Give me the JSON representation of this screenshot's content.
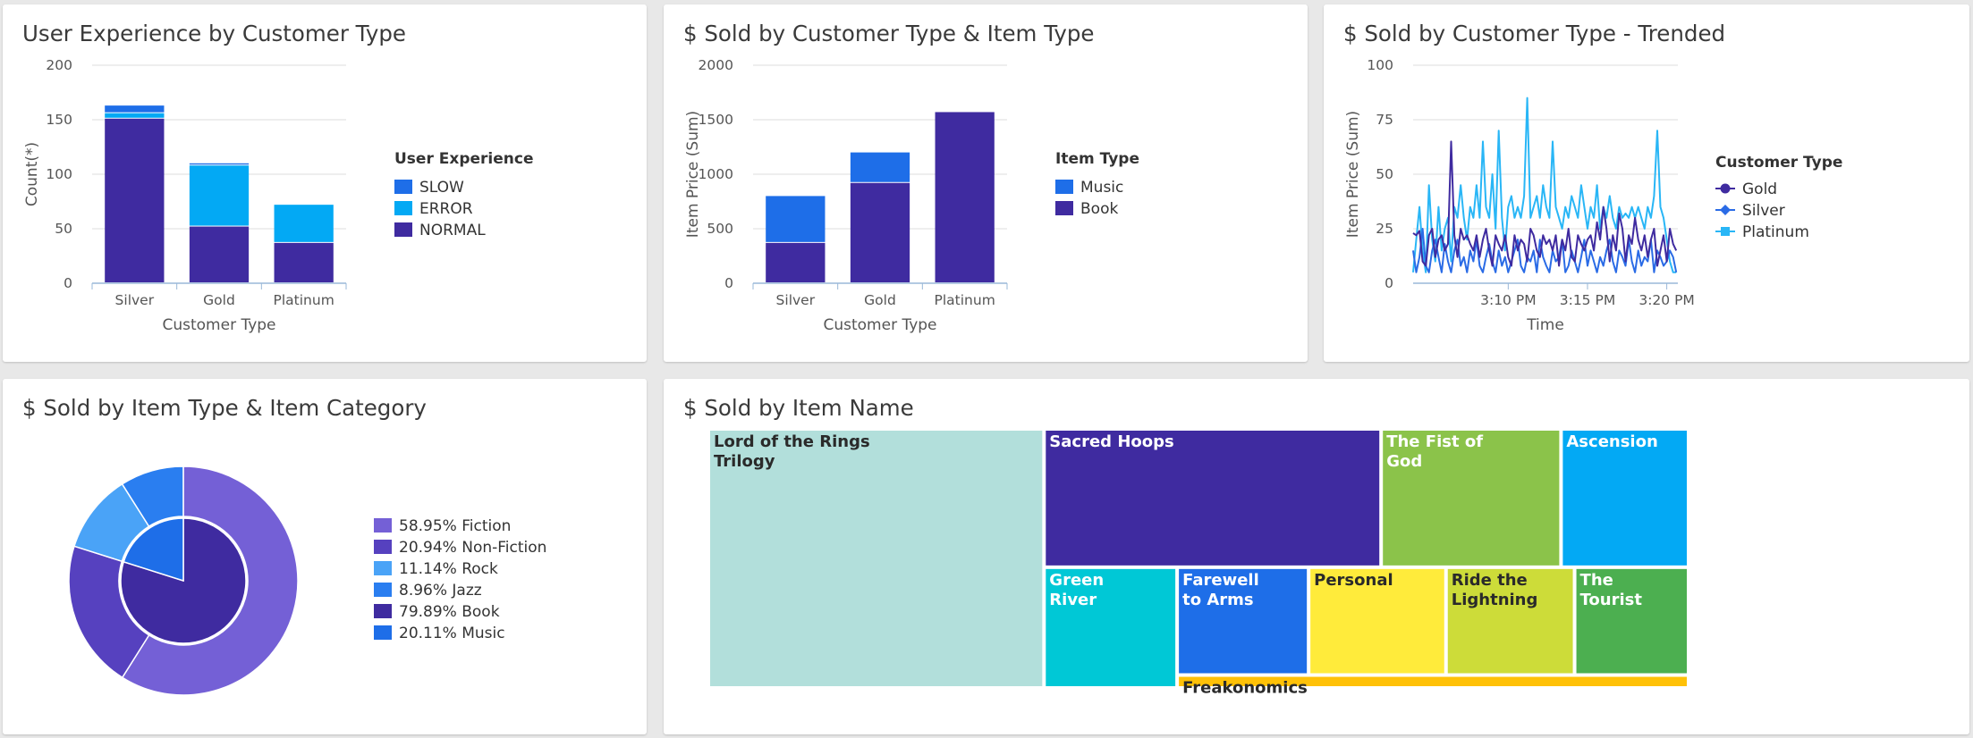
{
  "colors": {
    "normal": "#3f2ba0",
    "error": "#03a9f4",
    "slow": "#1e6ee8",
    "music": "#1e6ee8",
    "book": "#3f2ba0",
    "gold": "#3f2ba0",
    "silver": "#2a6be6",
    "platinum": "#29b6f6"
  },
  "chart_data": [
    {
      "type": "bar",
      "title": "User Experience by Customer Type",
      "xlabel": "Customer Type",
      "ylabel": "Count(*)",
      "ylim": [
        0,
        200
      ],
      "yticks": [
        0,
        50,
        100,
        150,
        200
      ],
      "categories": [
        "Silver",
        "Gold",
        "Platinum"
      ],
      "legend_title": "User Experience",
      "legend_placement": "right",
      "stacked": true,
      "series": [
        {
          "name": "NORMAL",
          "values": [
            151,
            52,
            37
          ]
        },
        {
          "name": "ERROR",
          "values": [
            5,
            56,
            35
          ]
        },
        {
          "name": "SLOW",
          "values": [
            7,
            2,
            0
          ]
        }
      ],
      "legend_order": [
        "SLOW",
        "ERROR",
        "NORMAL"
      ]
    },
    {
      "type": "bar",
      "title": "$ Sold by Customer Type & Item Type",
      "xlabel": "Customer Type",
      "ylabel": "Item Price (Sum)",
      "ylim": [
        0,
        2000
      ],
      "yticks": [
        0,
        500,
        1000,
        1500,
        2000
      ],
      "categories": [
        "Silver",
        "Gold",
        "Platinum"
      ],
      "legend_title": "Item Type",
      "legend_placement": "right",
      "stacked": true,
      "series": [
        {
          "name": "Book",
          "values": [
            370,
            920,
            1570
          ]
        },
        {
          "name": "Music",
          "values": [
            430,
            280,
            0
          ]
        }
      ],
      "legend_order": [
        "Music",
        "Book"
      ]
    },
    {
      "type": "line",
      "title": "$ Sold by Customer Type - Trended",
      "xlabel": "Time",
      "ylabel": "Item Price (Sum)",
      "ylim": [
        0,
        100
      ],
      "yticks": [
        0,
        25,
        50,
        75,
        100
      ],
      "xticks": [
        "3:10 PM",
        "3:15 PM",
        "3:20 PM"
      ],
      "xtick_positions": [
        6,
        11,
        16
      ],
      "xlim": [
        0,
        16.7
      ],
      "legend_title": "Customer Type",
      "legend_placement": "right",
      "series": [
        {
          "name": "Gold",
          "marker": "circle",
          "x": [
            0,
            0.2,
            0.4,
            0.6,
            0.8,
            1,
            1.2,
            1.4,
            1.6,
            1.8,
            2,
            2.2,
            2.4,
            2.6,
            2.8,
            3,
            3.2,
            3.4,
            3.6,
            3.8,
            4,
            4.2,
            4.4,
            4.6,
            4.8,
            5,
            5.2,
            5.4,
            5.6,
            5.8,
            6,
            6.2,
            6.4,
            6.6,
            6.8,
            7,
            7.2,
            7.4,
            7.6,
            7.8,
            8,
            8.2,
            8.4,
            8.6,
            8.8,
            9,
            9.2,
            9.4,
            9.6,
            9.8,
            10,
            10.2,
            10.4,
            10.6,
            10.8,
            11,
            11.2,
            11.4,
            11.6,
            11.8,
            12,
            12.2,
            12.4,
            12.6,
            12.8,
            13,
            13.2,
            13.4,
            13.6,
            13.8,
            14,
            14.2,
            14.4,
            14.6,
            14.8,
            15,
            15.2,
            15.4,
            15.6,
            15.8,
            16,
            16.2,
            16.4,
            16.6
          ],
          "y": [
            23,
            22,
            24,
            10,
            8,
            22,
            25,
            12,
            20,
            22,
            15,
            18,
            65,
            22,
            12,
            25,
            20,
            22,
            18,
            15,
            22,
            12,
            20,
            25,
            15,
            8,
            22,
            18,
            15,
            22,
            12,
            8,
            22,
            15,
            20,
            18,
            10,
            25,
            22,
            15,
            12,
            22,
            18,
            20,
            15,
            22,
            8,
            20,
            15,
            25,
            12,
            10,
            22,
            18,
            15,
            20,
            22,
            15,
            28,
            20,
            35,
            25,
            10,
            22,
            15,
            32,
            25,
            10,
            22,
            18,
            30,
            20,
            15,
            22,
            12,
            20,
            25,
            8,
            15,
            22,
            10,
            25,
            18,
            15
          ]
        },
        {
          "name": "Silver",
          "marker": "diamond",
          "x": [
            0,
            0.2,
            0.4,
            0.6,
            0.8,
            1,
            1.2,
            1.4,
            1.6,
            1.8,
            2,
            2.2,
            2.4,
            2.6,
            2.8,
            3,
            3.2,
            3.4,
            3.6,
            3.8,
            4,
            4.2,
            4.4,
            4.6,
            4.8,
            5,
            5.2,
            5.4,
            5.6,
            5.8,
            6,
            6.2,
            6.4,
            6.6,
            6.8,
            7,
            7.2,
            7.4,
            7.6,
            7.8,
            8,
            8.2,
            8.4,
            8.6,
            8.8,
            9,
            9.2,
            9.4,
            9.6,
            9.8,
            10,
            10.2,
            10.4,
            10.6,
            10.8,
            11,
            11.2,
            11.4,
            11.6,
            11.8,
            12,
            12.2,
            12.4,
            12.6,
            12.8,
            13,
            13.2,
            13.4,
            13.6,
            13.8,
            14,
            14.2,
            14.4,
            14.6,
            14.8,
            15,
            15.2,
            15.4,
            15.6,
            15.8,
            16,
            16.2,
            16.4,
            16.6
          ],
          "y": [
            15,
            5,
            12,
            25,
            8,
            5,
            15,
            20,
            12,
            5,
            18,
            10,
            5,
            15,
            20,
            8,
            12,
            5,
            15,
            10,
            20,
            8,
            5,
            12,
            18,
            10,
            5,
            15,
            8,
            12,
            5,
            10,
            15,
            20,
            8,
            5,
            12,
            10,
            15,
            5,
            20,
            12,
            8,
            5,
            15,
            10,
            12,
            20,
            5,
            8,
            15,
            10,
            5,
            12,
            20,
            8,
            15,
            10,
            5,
            12,
            8,
            15,
            20,
            10,
            5,
            15,
            12,
            8,
            20,
            10,
            5,
            15,
            8,
            12,
            10,
            20,
            5,
            15,
            12,
            8,
            10,
            15,
            12,
            5
          ]
        },
        {
          "name": "Platinum",
          "marker": "square",
          "x": [
            0,
            0.2,
            0.4,
            0.6,
            0.8,
            1,
            1.2,
            1.4,
            1.6,
            1.8,
            2,
            2.2,
            2.4,
            2.6,
            2.8,
            3,
            3.2,
            3.4,
            3.6,
            3.8,
            4,
            4.2,
            4.4,
            4.6,
            4.8,
            5,
            5.2,
            5.4,
            5.6,
            5.8,
            6,
            6.2,
            6.4,
            6.6,
            6.8,
            7,
            7.2,
            7.4,
            7.6,
            7.8,
            8,
            8.2,
            8.4,
            8.6,
            8.8,
            9,
            9.2,
            9.4,
            9.6,
            9.8,
            10,
            10.2,
            10.4,
            10.6,
            10.8,
            11,
            11.2,
            11.4,
            11.6,
            11.8,
            12,
            12.2,
            12.4,
            12.6,
            12.8,
            13,
            13.2,
            13.4,
            13.6,
            13.8,
            14,
            14.2,
            14.4,
            14.6,
            14.8,
            15,
            15.2,
            15.4,
            15.6,
            15.8,
            16,
            16.2,
            16.4,
            16.6
          ],
          "y": [
            5,
            20,
            35,
            15,
            5,
            45,
            20,
            10,
            35,
            15,
            25,
            30,
            10,
            35,
            30,
            45,
            30,
            20,
            35,
            30,
            45,
            30,
            65,
            35,
            30,
            50,
            25,
            70,
            30,
            15,
            35,
            40,
            30,
            35,
            30,
            40,
            85,
            30,
            35,
            40,
            30,
            45,
            35,
            30,
            65,
            35,
            30,
            25,
            35,
            30,
            40,
            35,
            30,
            45,
            35,
            25,
            35,
            30,
            45,
            25,
            35,
            30,
            40,
            30,
            25,
            35,
            30,
            32,
            30,
            35,
            30,
            35,
            30,
            25,
            35,
            30,
            40,
            70,
            35,
            30,
            20,
            10,
            5,
            5
          ]
        }
      ]
    },
    {
      "type": "pie",
      "title": "$ Sold by Item Type & Item Category",
      "legend_placement": "right",
      "inner": [
        {
          "name": "Book",
          "label": "79.89% Book",
          "value": 79.89,
          "color": "#3f2ba0"
        },
        {
          "name": "Music",
          "label": "20.11% Music",
          "value": 20.11,
          "color": "#1e6ee8"
        }
      ],
      "outer": [
        {
          "name": "Fiction",
          "label": "58.95% Fiction",
          "value": 58.95,
          "color": "#7460d6"
        },
        {
          "name": "Non-Fiction",
          "label": "20.94% Non-Fiction",
          "value": 20.94,
          "color": "#5641bf"
        },
        {
          "name": "Rock",
          "label": "11.14% Rock",
          "value": 11.14,
          "color": "#4aa3f7"
        },
        {
          "name": "Jazz",
          "label": "8.96% Jazz",
          "value": 8.96,
          "color": "#2a7ef0"
        }
      ],
      "legend_order": [
        "Fiction",
        "Non-Fiction",
        "Rock",
        "Jazz",
        "Book",
        "Music"
      ]
    },
    {
      "type": "treemap",
      "title": "$ Sold by Item Name",
      "items": [
        {
          "name": "Lord of the Rings Trilogy",
          "lines": [
            "Lord of the Rings",
            "Trilogy"
          ],
          "value": 276,
          "color": "#b2dfdb",
          "dark": true
        },
        {
          "name": "Sacred Hoops",
          "lines": [
            "Sacred Hoops"
          ],
          "value": 148,
          "color": "#3f2ba0",
          "dark": false
        },
        {
          "name": "The Fist of God",
          "lines": [
            "The Fist of",
            "God"
          ],
          "value": 79,
          "color": "#8bc34a",
          "dark": false
        },
        {
          "name": "Ascension",
          "lines": [
            "Ascension"
          ],
          "value": 56,
          "color": "#03a9f4",
          "dark": false
        },
        {
          "name": "Green River",
          "lines": [
            "Green",
            "River"
          ],
          "value": 51,
          "color": "#00c8d6",
          "dark": false
        },
        {
          "name": "Farewell to Arms",
          "lines": [
            "Farewell",
            "to Arms"
          ],
          "value": 45,
          "color": "#1e6ee8",
          "dark": false
        },
        {
          "name": "Personal",
          "lines": [
            "Personal"
          ],
          "value": 47,
          "color": "#ffeb3b",
          "dark": true
        },
        {
          "name": "Ride the Lightning",
          "lines": [
            "Ride the",
            "Lightning"
          ],
          "value": 44,
          "color": "#cddc39",
          "dark": true
        },
        {
          "name": "The Tourist",
          "lines": [
            "The",
            "Tourist"
          ],
          "value": 39,
          "color": "#4caf50",
          "dark": false
        },
        {
          "name": "Freakonomics",
          "lines": [
            "Freakonomics"
          ],
          "value": 21,
          "color": "#ffc107",
          "dark": true
        }
      ]
    }
  ]
}
